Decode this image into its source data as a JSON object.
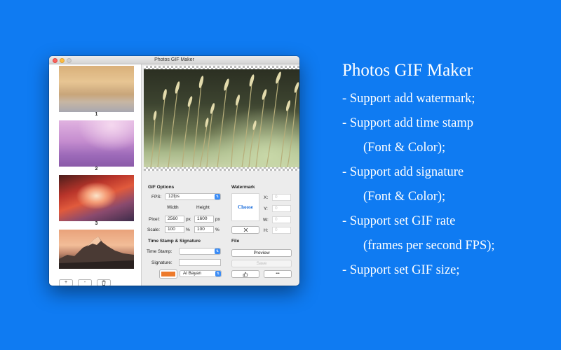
{
  "window": {
    "title": "Photos GIF Maker"
  },
  "sidebar": {
    "frames": [
      {
        "label": "1"
      },
      {
        "label": "2"
      },
      {
        "label": "3"
      },
      {
        "label": ""
      }
    ],
    "buttons": {
      "add": "+",
      "remove": "-",
      "delete_icon": "trash-icon"
    }
  },
  "gif_options": {
    "heading": "GIF Options",
    "fps_label": "FPS:",
    "fps_value": "12fps",
    "width_header": "Width",
    "height_header": "Height",
    "pixel_label": "Pixel:",
    "pixel_width": "2560",
    "pixel_height": "1600",
    "px_unit": "px",
    "scale_label": "Scale:",
    "scale_width": "100",
    "scale_height": "100",
    "pct_unit": "%"
  },
  "timestamp_signature": {
    "heading": "Time Stamp & Signature",
    "timestamp_label": "Time Stamp:",
    "timestamp_value": "",
    "signature_label": "Signature:",
    "signature_value": "",
    "color": "#ed7a2b",
    "font_value": "Al Bayan"
  },
  "watermark": {
    "heading": "Watermark",
    "choose_label": "Choose",
    "x_label": "X:",
    "x_value": "0",
    "y_label": "Y:",
    "y_value": "0",
    "w_label": "W:",
    "w_value": "0",
    "h_label": "H:",
    "h_value": "0",
    "clear_icon": "close-icon"
  },
  "file": {
    "heading": "File",
    "preview_label": "Preview",
    "save_label": "Save",
    "like_icon": "thumbs-up-icon",
    "more_icon": "more-icon",
    "more_label": "•••"
  },
  "description": {
    "title": "Photos GIF Maker",
    "lines": [
      "- Support add watermark;",
      "- Support add time stamp",
      "(Font & Color);",
      "- Support add signature",
      "(Font & Color);",
      "- Support set GIF rate",
      "(frames per second FPS);",
      "- Support set GIF size;"
    ]
  },
  "colors": {
    "background": "#0f7bf2",
    "accent": "#3b8cf5",
    "swatch": "#ed7a2b"
  }
}
